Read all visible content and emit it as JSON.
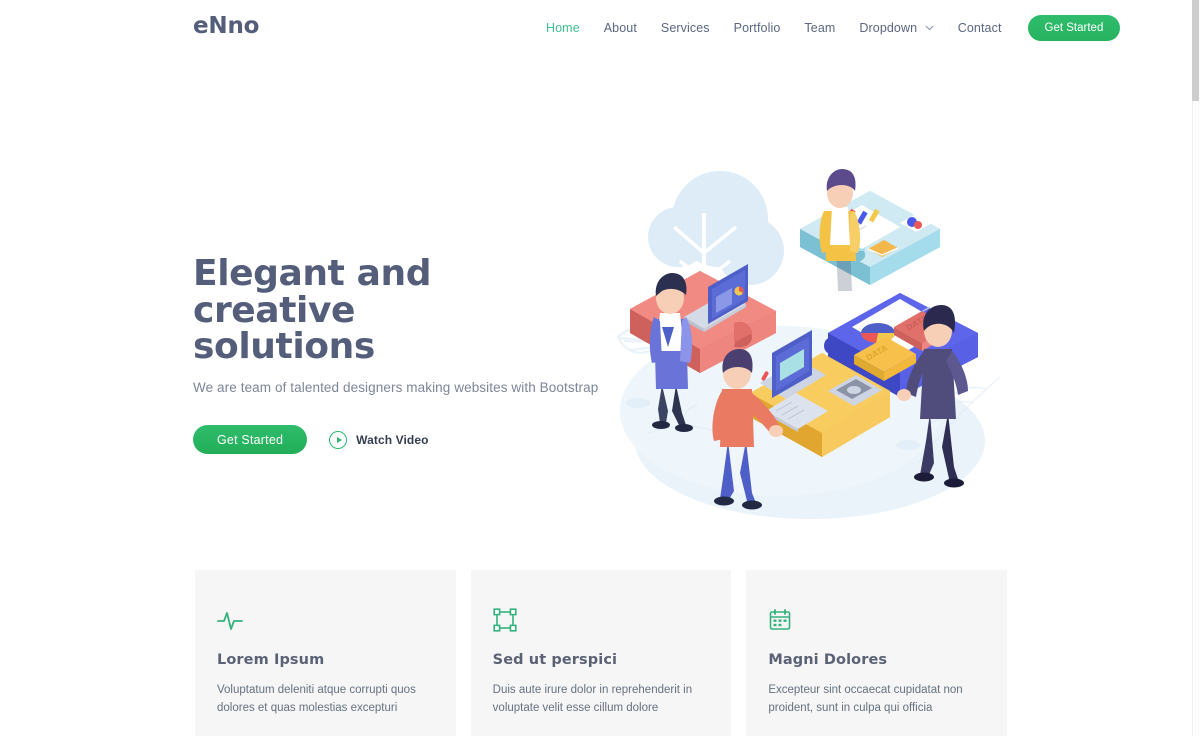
{
  "header": {
    "logo": "eNno",
    "nav_items": [
      {
        "label": "Home",
        "active": true,
        "has_chevron": false
      },
      {
        "label": "About",
        "active": false,
        "has_chevron": false
      },
      {
        "label": "Services",
        "active": false,
        "has_chevron": false
      },
      {
        "label": "Portfolio",
        "active": false,
        "has_chevron": false
      },
      {
        "label": "Team",
        "active": false,
        "has_chevron": false
      },
      {
        "label": "Dropdown",
        "active": false,
        "has_chevron": true
      },
      {
        "label": "Contact",
        "active": false,
        "has_chevron": false
      }
    ],
    "cta_label": "Get Started"
  },
  "hero": {
    "title": "Elegant and creative solutions",
    "subtitle": "We are team of talented designers making websites with Bootstrap",
    "cta_label": "Get Started",
    "video_label": "Watch Video",
    "illustration_alt": "isometric-team-collaboration-illustration"
  },
  "cards": [
    {
      "icon": "activity-pulse-icon",
      "title": "Lorem Ipsum",
      "description": "Voluptatum deleniti atque corrupti quos dolores et quas molestias excepturi"
    },
    {
      "icon": "bounding-box-icon",
      "title": "Sed ut perspici",
      "description": "Duis aute irure dolor in reprehenderit in voluptate velit esse cillum dolore"
    },
    {
      "icon": "calendar-icon",
      "title": "Magni Dolores",
      "description": "Excepteur sint occaecat cupidatat non proident, sunt in culpa qui officia"
    }
  ],
  "colors": {
    "accent_green": "#29b765",
    "nav_active": "#3ec28f",
    "heading": "#545d7a",
    "body_text": "#7d8597",
    "card_bg": "#f6f6f6",
    "icon_green": "#2eb872"
  }
}
